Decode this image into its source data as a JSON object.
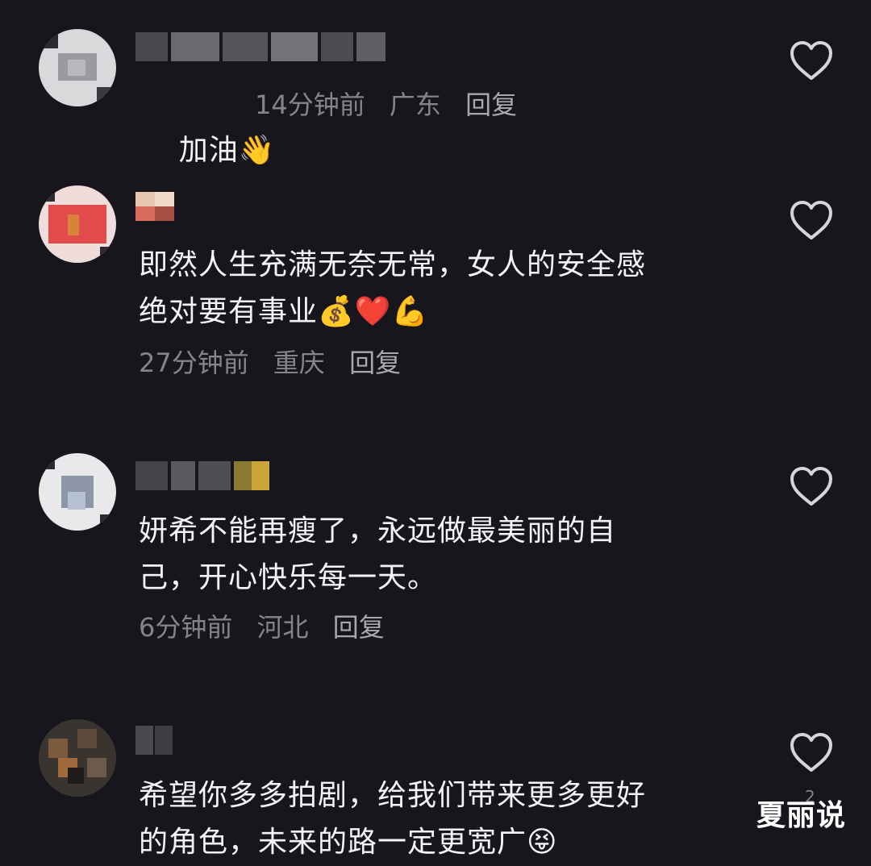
{
  "comments": [
    {
      "text": "加油👋",
      "time": "14分钟前",
      "location": "广东",
      "reply_label": "回复",
      "inline_meta": true
    },
    {
      "text": "即然人生充满无奈无常，女人的安全感\n绝对要有事业💰❤️💪",
      "time": "27分钟前",
      "location": "重庆",
      "reply_label": "回复"
    },
    {
      "text": "妍希不能再瘦了，永远做最美丽的自\n己，开心快乐每一天。",
      "time": "6分钟前",
      "location": "河北",
      "reply_label": "回复"
    },
    {
      "text": "希望你多多拍剧，给我们带来更多更好\n的角色，未来的路一定更宽广😝",
      "like_count": "2"
    }
  ],
  "watermark": "夏丽说",
  "colors": {
    "background": "#17161c",
    "text": "#f4f4f6",
    "meta": "#85848c",
    "icon": "#d6d6da"
  },
  "icons": {
    "like": "heart-outline-icon"
  }
}
